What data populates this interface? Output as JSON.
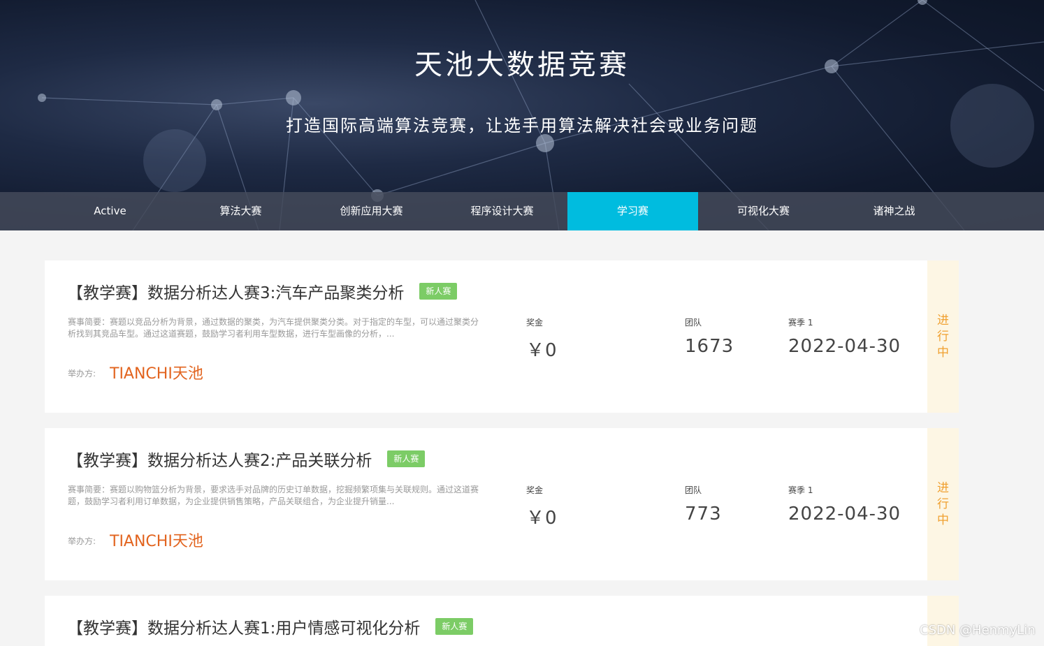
{
  "hero": {
    "title": "天池大数据竞赛",
    "subtitle": "打造国际高端算法竞赛，让选手用算法解决社会或业务问题"
  },
  "tabs": [
    {
      "label": "Active"
    },
    {
      "label": "算法大赛"
    },
    {
      "label": "创新应用大赛"
    },
    {
      "label": "程序设计大赛"
    },
    {
      "label": "学习赛",
      "active": true
    },
    {
      "label": "可视化大赛"
    },
    {
      "label": "诸神之战"
    }
  ],
  "labels": {
    "organizer": "举办方:",
    "prize": "奖金",
    "team": "团队",
    "season": "赛季 1"
  },
  "organizer_logo_text": "TIANCHI天池",
  "competitions": [
    {
      "title": "【教学赛】数据分析达人赛3:汽车产品聚类分析",
      "badge": "新人赛",
      "summary": "赛事简要：赛题以竞品分析为背景，通过数据的聚类，为汽车提供聚类分类。对于指定的车型，可以通过聚类分析找到其竞品车型。通过这道赛题，鼓励学习者利用车型数据，进行车型画像的分析，...",
      "prize": "￥0",
      "team": "1673",
      "date": "2022-04-30",
      "status": [
        "进",
        "行",
        "中"
      ]
    },
    {
      "title": "【教学赛】数据分析达人赛2:产品关联分析",
      "badge": "新人赛",
      "summary": "赛事简要：赛题以购物篮分析为背景，要求选手对品牌的历史订单数据，挖掘频繁项集与关联规则。通过这道赛题，鼓励学习者利用订单数据，为企业提供销售策略，产品关联组合，为企业提升销量...",
      "prize": "￥0",
      "team": "773",
      "date": "2022-04-30",
      "status": [
        "进",
        "行",
        "中"
      ]
    },
    {
      "title": "【教学赛】数据分析达人赛1:用户情感可视化分析",
      "badge": "新人赛"
    }
  ],
  "watermark": "CSDN @HenmyLin",
  "colors": {
    "accent": "#00bcdf",
    "badge": "#7ccc66",
    "status_text": "#f0a030",
    "status_bg": "#fdf6e4",
    "logo": "#e2641f"
  }
}
